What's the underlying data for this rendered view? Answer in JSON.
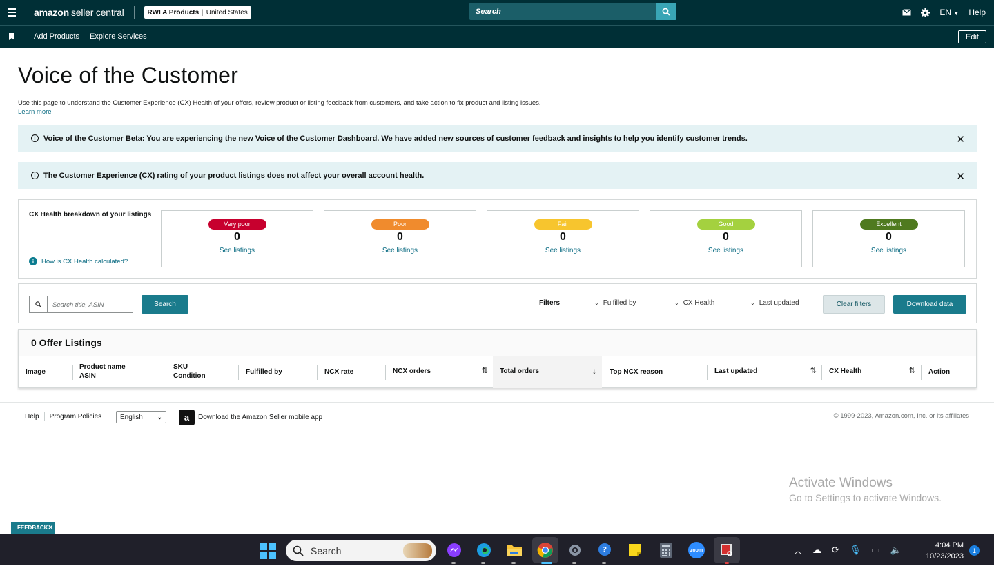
{
  "topbar": {
    "logo_brand": "amazon",
    "logo_product": "seller central",
    "account_name": "RWI A Products",
    "account_region": "United States",
    "search_placeholder": "Search",
    "language": "EN",
    "help": "Help"
  },
  "nav": {
    "items": [
      "Add Products",
      "Explore Services"
    ],
    "edit": "Edit"
  },
  "page": {
    "title": "Voice of the Customer",
    "description": "Use this page to understand the Customer Experience (CX) Health of your offers, review product or listing feedback from customers, and take action to fix product and listing issues.",
    "learn_more": "Learn more"
  },
  "alerts": [
    {
      "text": "Voice of the Customer Beta: You are experiencing the new Voice of the Customer Dashboard. We have added new sources of customer feedback and insights to help you identify customer trends."
    },
    {
      "text": "The Customer Experience (CX) rating of your product listings does not affect your overall account health."
    }
  ],
  "cx_health": {
    "title": "CX Health breakdown of your listings",
    "how_link": "How is CX Health calculated?",
    "cards": [
      {
        "label": "Very poor",
        "count": "0",
        "link": "See listings",
        "color": "#c7002e"
      },
      {
        "label": "Poor",
        "count": "0",
        "link": "See listings",
        "color": "#f08b2d"
      },
      {
        "label": "Fair",
        "count": "0",
        "link": "See listings",
        "color": "#f7c52e"
      },
      {
        "label": "Good",
        "count": "0",
        "link": "See listings",
        "color": "#a4d13f"
      },
      {
        "label": "Excellent",
        "count": "0",
        "link": "See listings",
        "color": "#4f7a1f"
      }
    ]
  },
  "toolbar": {
    "search_placeholder": "Search title, ASIN",
    "search_button": "Search",
    "filters_label": "Filters",
    "filter_fulfilled": "Fulfilled by",
    "filter_cx": "CX Health",
    "filter_updated": "Last updated",
    "clear_filters": "Clear filters",
    "download": "Download data"
  },
  "listings": {
    "header": "0 Offer Listings",
    "columns": {
      "image": "Image",
      "product_name": "Product name",
      "asin": "ASIN",
      "sku": "SKU",
      "condition": "Condition",
      "fulfilled_by": "Fulfilled by",
      "ncx_rate": "NCX rate",
      "ncx_orders": "NCX orders",
      "total_orders": "Total orders",
      "top_ncx_reason": "Top NCX reason",
      "last_updated": "Last updated",
      "cx_health": "CX Health",
      "action": "Action"
    }
  },
  "footer": {
    "help": "Help",
    "program_policies": "Program Policies",
    "language": "English",
    "app_text": "Download the Amazon Seller mobile app",
    "copyright": "© 1999-2023, Amazon.com, Inc. or its affiliates"
  },
  "watermark": {
    "line1": "Activate Windows",
    "line2": "Go to Settings to activate Windows."
  },
  "feedback": "FEEDBACK",
  "taskbar": {
    "search": "Search",
    "time": "4:04 PM",
    "date": "10/23/2023",
    "notifications": "1",
    "zoom_label": "zoom"
  }
}
